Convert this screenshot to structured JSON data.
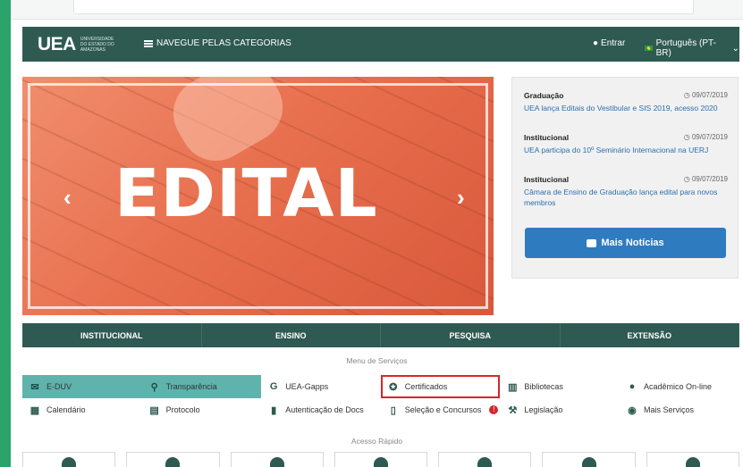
{
  "header": {
    "logo": "UEA",
    "logo_sub": "UNIVERSIDADE DO ESTADO DO AMAZONAS",
    "nav_label": "NAVEGUE PELAS CATEGORIAS",
    "login_label": "Entrar",
    "language_label": "Português (PT-BR)"
  },
  "banner": {
    "text": "EDITAL",
    "prev": "‹",
    "next": "›"
  },
  "news": {
    "items": [
      {
        "category": "Graduação",
        "date": "09/07/2019",
        "title": "UEA lança Editais do Vestibular e SIS 2019, acesso 2020"
      },
      {
        "category": "Institucional",
        "date": "09/07/2019",
        "title": "UEA participa do 10º Seminário Internacional na UERJ"
      },
      {
        "category": "Institucional",
        "date": "09/07/2019",
        "title": "Câmara de Ensino de Graduação lança edital para novos membros"
      }
    ],
    "more_button": "Mais Notícias"
  },
  "tabs": [
    "INSTITUCIONAL",
    "ENSINO",
    "PESQUISA",
    "EXTENSÃO"
  ],
  "services": {
    "title": "Menu de Serviços",
    "row1": [
      {
        "label": "E-DUV",
        "icon": "envelope-icon"
      },
      {
        "label": "Transparência",
        "icon": "search-icon"
      },
      {
        "label": "UEA-Gapps",
        "icon": "google-icon"
      },
      {
        "label": "Certificados",
        "icon": "award-icon"
      },
      {
        "label": "Bibliotecas",
        "icon": "library-icon"
      },
      {
        "label": "Acadêmico On-line",
        "icon": "user-icon"
      }
    ],
    "row2": [
      {
        "label": "Calendário",
        "icon": "calendar-icon"
      },
      {
        "label": "Protocolo",
        "icon": "document-icon"
      },
      {
        "label": "Autenticação de Docs",
        "icon": "file-icon"
      },
      {
        "label": "Seleção e Concursos",
        "icon": "file-outline-icon",
        "badge": "!"
      },
      {
        "label": "Legislação",
        "icon": "gavel-icon"
      },
      {
        "label": "Mais Serviços",
        "icon": "chevron-circle-icon"
      }
    ]
  },
  "quick_access": {
    "title": "Acesso Rápido"
  }
}
